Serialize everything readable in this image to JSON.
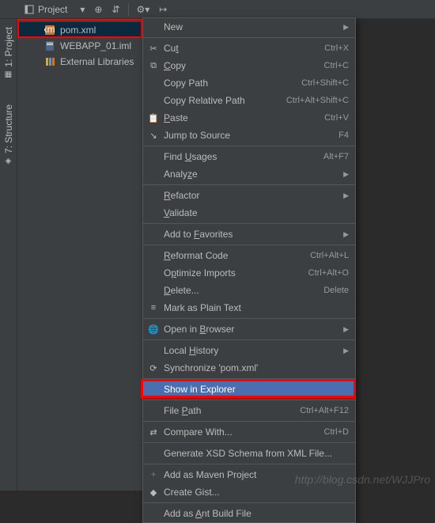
{
  "topbar": {
    "project_label": "Project"
  },
  "sidebar_tabs": {
    "project": "1: Project",
    "structure": "7: Structure"
  },
  "tree": {
    "items": [
      {
        "label": "pom.xml",
        "icon": "xml",
        "selected": true
      },
      {
        "label": "WEBAPP_01.iml",
        "icon": "iml",
        "selected": false
      },
      {
        "label": "External Libraries",
        "icon": "lib",
        "selected": false
      }
    ]
  },
  "menu": [
    {
      "type": "item",
      "label": "New",
      "arrow": true
    },
    {
      "type": "sep"
    },
    {
      "type": "item",
      "icon": "✂",
      "label": "Cut",
      "underline": 2,
      "shortcut": "Ctrl+X"
    },
    {
      "type": "item",
      "icon": "⧉",
      "label": "Copy",
      "underline": 0,
      "shortcut": "Ctrl+C"
    },
    {
      "type": "item",
      "label": "Copy Path",
      "shortcut": "Ctrl+Shift+C"
    },
    {
      "type": "item",
      "label": "Copy Relative Path",
      "shortcut": "Ctrl+Alt+Shift+C"
    },
    {
      "type": "item",
      "icon": "📋",
      "label": "Paste",
      "underline": 0,
      "shortcut": "Ctrl+V"
    },
    {
      "type": "item",
      "icon": "↘",
      "label": "Jump to Source",
      "shortcut": "F4"
    },
    {
      "type": "sep"
    },
    {
      "type": "item",
      "label": "Find Usages",
      "underline": 5,
      "shortcut": "Alt+F7"
    },
    {
      "type": "item",
      "label": "Analyze",
      "underline": 5,
      "arrow": true
    },
    {
      "type": "sep"
    },
    {
      "type": "item",
      "label": "Refactor",
      "underline": 0,
      "arrow": true
    },
    {
      "type": "item",
      "label": "Validate",
      "underline": 0
    },
    {
      "type": "sep"
    },
    {
      "type": "item",
      "label": "Add to Favorites",
      "underline": 7,
      "arrow": true
    },
    {
      "type": "sep"
    },
    {
      "type": "item",
      "label": "Reformat Code",
      "underline": 0,
      "shortcut": "Ctrl+Alt+L"
    },
    {
      "type": "item",
      "label": "Optimize Imports",
      "underline": 1,
      "shortcut": "Ctrl+Alt+O"
    },
    {
      "type": "item",
      "label": "Delete...",
      "underline": 0,
      "shortcut": "Delete"
    },
    {
      "type": "item",
      "icon": "≡",
      "label": "Mark as Plain Text"
    },
    {
      "type": "sep"
    },
    {
      "type": "item",
      "icon": "🌐",
      "label": "Open in Browser",
      "underline": 8,
      "arrow": true
    },
    {
      "type": "sep"
    },
    {
      "type": "item",
      "label": "Local History",
      "underline": 6,
      "arrow": true
    },
    {
      "type": "item",
      "icon": "⟳",
      "label": "Synchronize 'pom.xml'"
    },
    {
      "type": "sep"
    },
    {
      "type": "item",
      "label": "Show in Explorer",
      "hovered": true,
      "highlight": true
    },
    {
      "type": "sep"
    },
    {
      "type": "item",
      "label": "File Path",
      "underline": 5,
      "shortcut": "Ctrl+Alt+F12"
    },
    {
      "type": "sep"
    },
    {
      "type": "item",
      "icon": "⇄",
      "label": "Compare With...",
      "shortcut": "Ctrl+D"
    },
    {
      "type": "sep"
    },
    {
      "type": "item",
      "label": "Generate XSD Schema from XML File..."
    },
    {
      "type": "sep"
    },
    {
      "type": "item",
      "icon": "+",
      "iconColor": "#629755",
      "label": "Add as Maven Project"
    },
    {
      "type": "item",
      "icon": "◆",
      "label": "Create Gist..."
    },
    {
      "type": "sep"
    },
    {
      "type": "item",
      "label": "Add as Ant Build File",
      "underline": 7
    }
  ],
  "watermark": "http://blog.csdn.net/WJJPro"
}
